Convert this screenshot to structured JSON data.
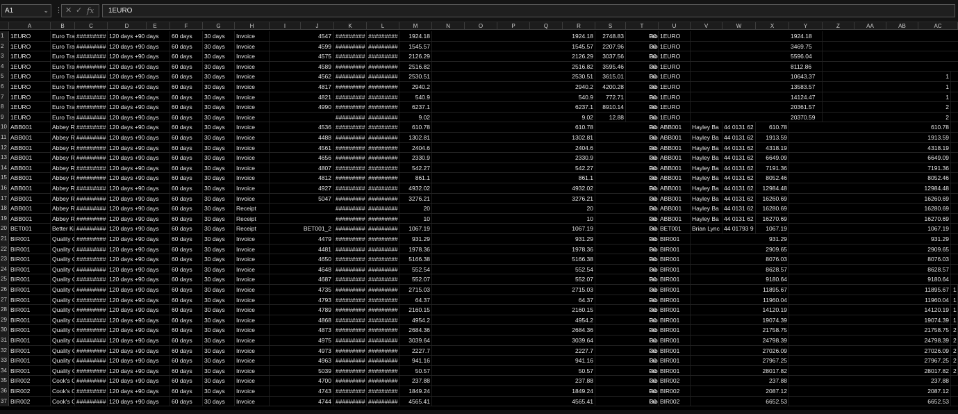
{
  "formula_bar": {
    "name_box": "A1",
    "formula": "1EURO",
    "icons": [
      "chevron-down-icon",
      "more-vertical-icon",
      "cancel-icon",
      "confirm-icon",
      "function-icon"
    ]
  },
  "columns": [
    "A",
    "B",
    "C",
    "D",
    "E",
    "F",
    "G",
    "H",
    "I",
    "J",
    "K",
    "L",
    "M",
    "N",
    "O",
    "P",
    "Q",
    "R",
    "S",
    "T",
    "U",
    "V",
    "W",
    "X",
    "Y",
    "Z",
    "AA",
    "AB",
    "AC"
  ],
  "rows": [
    {
      "n": "1",
      "A": "1EURO",
      "B": "Euro Tradi",
      "C": "#########",
      "D": "120 days +90 days",
      "F": "60 days",
      "G": "30 days",
      "H": "Invoice",
      "J": "4547",
      "K": "#########",
      "L": "#########",
      "M": "1924.18",
      "R": "1924.18",
      "S": "2748.83",
      "T": "30",
      "Tb": "From docu",
      "U": "1EURO",
      "V": "",
      "W": "",
      "X": "",
      "Y": "1924.18",
      "AC": ""
    },
    {
      "n": "2",
      "A": "1EURO",
      "B": "Euro Tradi",
      "C": "#########",
      "D": "120 days +90 days",
      "F": "60 days",
      "G": "30 days",
      "H": "Invoice",
      "J": "4599",
      "K": "#########",
      "L": "#########",
      "M": "1545.57",
      "R": "1545.57",
      "S": "2207.96",
      "T": "30",
      "Tb": "From docu",
      "U": "1EURO",
      "V": "",
      "W": "",
      "X": "",
      "Y": "3469.75",
      "AC": ""
    },
    {
      "n": "3",
      "A": "1EURO",
      "B": "Euro Tradi",
      "C": "#########",
      "D": "120 days +90 days",
      "F": "60 days",
      "G": "30 days",
      "H": "Invoice",
      "J": "4575",
      "K": "#########",
      "L": "#########",
      "M": "2126.29",
      "R": "2126.29",
      "S": "3037.56",
      "T": "30",
      "Tb": "From docu",
      "U": "1EURO",
      "V": "",
      "W": "",
      "X": "",
      "Y": "5596.04",
      "AC": ""
    },
    {
      "n": "4",
      "A": "1EURO",
      "B": "Euro Tradi",
      "C": "#########",
      "D": "120 days +90 days",
      "F": "60 days",
      "G": "30 days",
      "H": "Invoice",
      "J": "4589",
      "K": "#########",
      "L": "#########",
      "M": "2516.82",
      "R": "2516.82",
      "S": "3595.46",
      "T": "30",
      "Tb": "From docu",
      "U": "1EURO",
      "V": "",
      "W": "",
      "X": "",
      "Y": "8112.86",
      "AC": ""
    },
    {
      "n": "5",
      "A": "1EURO",
      "B": "Euro Tradi",
      "C": "#########",
      "D": "120 days +90 days",
      "F": "60 days",
      "G": "30 days",
      "H": "Invoice",
      "J": "4562",
      "K": "#########",
      "L": "#########",
      "M": "2530.51",
      "R": "2530.51",
      "S": "3615.01",
      "T": "30",
      "Tb": "From docu",
      "U": "1EURO",
      "V": "",
      "W": "",
      "X": "",
      "Y": "10643.37",
      "AC": "1"
    },
    {
      "n": "6",
      "A": "1EURO",
      "B": "Euro Tradi",
      "C": "#########",
      "D": "120 days +90 days",
      "F": "60 days",
      "G": "30 days",
      "H": "Invoice",
      "J": "4817",
      "K": "#########",
      "L": "#########",
      "M": "2940.2",
      "R": "2940.2",
      "S": "4200.28",
      "T": "30",
      "Tb": "From docu",
      "U": "1EURO",
      "V": "",
      "W": "",
      "X": "",
      "Y": "13583.57",
      "AC": "1"
    },
    {
      "n": "7",
      "A": "1EURO",
      "B": "Euro Tradi",
      "C": "#########",
      "D": "120 days +90 days",
      "F": "60 days",
      "G": "30 days",
      "H": "Invoice",
      "J": "4821",
      "K": "#########",
      "L": "#########",
      "M": "540.9",
      "R": "540.9",
      "S": "772.71",
      "T": "30",
      "Tb": "From docu",
      "U": "1EURO",
      "V": "",
      "W": "",
      "X": "",
      "Y": "14124.47",
      "AC": "1"
    },
    {
      "n": "8",
      "A": "1EURO",
      "B": "Euro Tradi",
      "C": "#########",
      "D": "120 days +90 days",
      "F": "60 days",
      "G": "30 days",
      "H": "Invoice",
      "J": "4990",
      "K": "#########",
      "L": "#########",
      "M": "6237.1",
      "R": "6237.1",
      "S": "8910.14",
      "T": "30",
      "Tb": "From docu",
      "U": "1EURO",
      "V": "",
      "W": "",
      "X": "",
      "Y": "20361.57",
      "AC": "2"
    },
    {
      "n": "9",
      "A": "1EURO",
      "B": "Euro Tradi",
      "C": "#########",
      "D": "120 days +90 days",
      "F": "60 days",
      "G": "30 days",
      "H": "Invoice",
      "J": "",
      "K": "#########",
      "L": "#########",
      "M": "9.02",
      "R": "9.02",
      "S": "12.88",
      "T": "30",
      "Tb": "From docu",
      "U": "1EURO",
      "V": "",
      "W": "",
      "X": "",
      "Y": "20370.59",
      "AC": "2"
    },
    {
      "n": "10",
      "A": "ABB001",
      "B": "Abbey Ret",
      "C": "#########",
      "D": "120 days +90 days",
      "F": "60 days",
      "G": "30 days",
      "H": "Invoice",
      "J": "4536",
      "K": "#########",
      "L": "#########",
      "M": "610.78",
      "R": "610.78",
      "S": "",
      "T": "30",
      "Tb": "From docu",
      "U": "ABB001",
      "V": "Hayley Ba",
      "W": "44 0131 62",
      "X": "610.78",
      "Y": "",
      "AC": "610.78"
    },
    {
      "n": "11",
      "A": "ABB001",
      "B": "Abbey Ret",
      "C": "#########",
      "D": "120 days +90 days",
      "F": "60 days",
      "G": "30 days",
      "H": "Invoice",
      "J": "4488",
      "K": "#########",
      "L": "#########",
      "M": "1302.81",
      "R": "1302.81",
      "S": "",
      "T": "30",
      "Tb": "From docu",
      "U": "ABB001",
      "V": "Hayley Ba",
      "W": "44 0131 62",
      "X": "1913.59",
      "Y": "",
      "AC": "1913.59"
    },
    {
      "n": "12",
      "A": "ABB001",
      "B": "Abbey Ret",
      "C": "#########",
      "D": "120 days +90 days",
      "F": "60 days",
      "G": "30 days",
      "H": "Invoice",
      "J": "4561",
      "K": "#########",
      "L": "#########",
      "M": "2404.6",
      "R": "2404.6",
      "S": "",
      "T": "30",
      "Tb": "From docu",
      "U": "ABB001",
      "V": "Hayley Ba",
      "W": "44 0131 62",
      "X": "4318.19",
      "Y": "",
      "AC": "4318.19"
    },
    {
      "n": "13",
      "A": "ABB001",
      "B": "Abbey Ret",
      "C": "#########",
      "D": "120 days +90 days",
      "F": "60 days",
      "G": "30 days",
      "H": "Invoice",
      "J": "4656",
      "K": "#########",
      "L": "#########",
      "M": "2330.9",
      "R": "2330.9",
      "S": "",
      "T": "30",
      "Tb": "From docu",
      "U": "ABB001",
      "V": "Hayley Ba",
      "W": "44 0131 62",
      "X": "6649.09",
      "Y": "",
      "AC": "6649.09"
    },
    {
      "n": "14",
      "A": "ABB001",
      "B": "Abbey Ret",
      "C": "#########",
      "D": "120 days +90 days",
      "F": "60 days",
      "G": "30 days",
      "H": "Invoice",
      "J": "4807",
      "K": "#########",
      "L": "#########",
      "M": "542.27",
      "R": "542.27",
      "S": "",
      "T": "30",
      "Tb": "From docu",
      "U": "ABB001",
      "V": "Hayley Ba",
      "W": "44 0131 62",
      "X": "7191.36",
      "Y": "",
      "AC": "7191.36"
    },
    {
      "n": "15",
      "A": "ABB001",
      "B": "Abbey Ret",
      "C": "#########",
      "D": "120 days +90 days",
      "F": "60 days",
      "G": "30 days",
      "H": "Invoice",
      "J": "4812",
      "K": "#########",
      "L": "#########",
      "M": "861.1",
      "R": "861.1",
      "S": "",
      "T": "30",
      "Tb": "From docu",
      "U": "ABB001",
      "V": "Hayley Ba",
      "W": "44 0131 62",
      "X": "8052.46",
      "Y": "",
      "AC": "8052.46"
    },
    {
      "n": "16",
      "A": "ABB001",
      "B": "Abbey Ret",
      "C": "#########",
      "D": "120 days +90 days",
      "F": "60 days",
      "G": "30 days",
      "H": "Invoice",
      "J": "4927",
      "K": "#########",
      "L": "#########",
      "M": "4932.02",
      "R": "4932.02",
      "S": "",
      "T": "30",
      "Tb": "From docu",
      "U": "ABB001",
      "V": "Hayley Ba",
      "W": "44 0131 62",
      "X": "12984.48",
      "Y": "",
      "AC": "12984.48"
    },
    {
      "n": "17",
      "A": "ABB001",
      "B": "Abbey Ret",
      "C": "#########",
      "D": "120 days +90 days",
      "F": "60 days",
      "G": "30 days",
      "H": "Invoice",
      "J": "5047",
      "K": "#########",
      "L": "#########",
      "M": "3276.21",
      "R": "3276.21",
      "S": "",
      "T": "30",
      "Tb": "From docu",
      "U": "ABB001",
      "V": "Hayley Ba",
      "W": "44 0131 62",
      "X": "16260.69",
      "Y": "",
      "AC": "16260.69"
    },
    {
      "n": "18",
      "A": "ABB001",
      "B": "Abbey Ret",
      "C": "#########",
      "D": "120 days +90 days",
      "F": "60 days",
      "G": "30 days",
      "H": "Receipt",
      "J": "",
      "K": "#########",
      "L": "#########",
      "M": "20",
      "R": "20",
      "S": "",
      "T": "30",
      "Tb": "From docu",
      "U": "ABB001",
      "V": "Hayley Ba",
      "W": "44 0131 62",
      "X": "16280.69",
      "Y": "",
      "AC": "16280.69"
    },
    {
      "n": "19",
      "A": "ABB001",
      "B": "Abbey Ret",
      "C": "#########",
      "D": "120 days +90 days",
      "F": "60 days",
      "G": "30 days",
      "H": "Receipt",
      "J": "",
      "K": "#########",
      "L": "#########",
      "M": "10",
      "R": "10",
      "S": "",
      "T": "30",
      "Tb": "From docu",
      "U": "ABB001",
      "V": "Hayley Ba",
      "W": "44 0131 62",
      "X": "16270.69",
      "Y": "",
      "AC": "16270.69"
    },
    {
      "n": "20",
      "A": "BET001",
      "B": "Better Kit",
      "C": "#########",
      "D": "120 days +90 days",
      "F": "60 days",
      "G": "30 days",
      "H": "Receipt",
      "J": "BET001_2",
      "K": "#########",
      "L": "#########",
      "M": "1067.19",
      "R": "1067.19",
      "S": "",
      "T": "30",
      "Tb": "From docu",
      "U": "BET001",
      "V": "Brian Lync",
      "W": "44 01793 9",
      "X": "1067.19",
      "Y": "",
      "AC": "1067.19"
    },
    {
      "n": "21",
      "A": "BIR001",
      "B": "Quality Co",
      "C": "#########",
      "D": "120 days +90 days",
      "F": "60 days",
      "G": "30 days",
      "H": "Invoice",
      "J": "4479",
      "K": "#########",
      "L": "#########",
      "M": "931.29",
      "R": "931.29",
      "S": "",
      "T": "30",
      "Tb": "From docu",
      "U": "BIR001",
      "V": "",
      "W": "",
      "X": "931.29",
      "Y": "",
      "AC": "931.29"
    },
    {
      "n": "22",
      "A": "BIR001",
      "B": "Quality Co",
      "C": "#########",
      "D": "120 days +90 days",
      "F": "60 days",
      "G": "30 days",
      "H": "Invoice",
      "J": "4481",
      "K": "#########",
      "L": "#########",
      "M": "1978.36",
      "R": "1978.36",
      "S": "",
      "T": "30",
      "Tb": "From docu",
      "U": "BIR001",
      "V": "",
      "W": "",
      "X": "2909.65",
      "Y": "",
      "AC": "2909.65"
    },
    {
      "n": "23",
      "A": "BIR001",
      "B": "Quality Co",
      "C": "#########",
      "D": "120 days +90 days",
      "F": "60 days",
      "G": "30 days",
      "H": "Invoice",
      "J": "4650",
      "K": "#########",
      "L": "#########",
      "M": "5166.38",
      "R": "5166.38",
      "S": "",
      "T": "30",
      "Tb": "From docu",
      "U": "BIR001",
      "V": "",
      "W": "",
      "X": "8076.03",
      "Y": "",
      "AC": "8076.03"
    },
    {
      "n": "24",
      "A": "BIR001",
      "B": "Quality Co",
      "C": "#########",
      "D": "120 days +90 days",
      "F": "60 days",
      "G": "30 days",
      "H": "Invoice",
      "J": "4648",
      "K": "#########",
      "L": "#########",
      "M": "552.54",
      "R": "552.54",
      "S": "",
      "T": "30",
      "Tb": "From docu",
      "U": "BIR001",
      "V": "",
      "W": "",
      "X": "8628.57",
      "Y": "",
      "AC": "8628.57"
    },
    {
      "n": "25",
      "A": "BIR001",
      "B": "Quality Co",
      "C": "#########",
      "D": "120 days +90 days",
      "F": "60 days",
      "G": "30 days",
      "H": "Invoice",
      "J": "4687",
      "K": "#########",
      "L": "#########",
      "M": "552.07",
      "R": "552.07",
      "S": "",
      "T": "30",
      "Tb": "From docu",
      "U": "BIR001",
      "V": "",
      "W": "",
      "X": "9180.64",
      "Y": "",
      "AC": "9180.64"
    },
    {
      "n": "26",
      "A": "BIR001",
      "B": "Quality Co",
      "C": "#########",
      "D": "120 days +90 days",
      "F": "60 days",
      "G": "30 days",
      "H": "Invoice",
      "J": "4735",
      "K": "#########",
      "L": "#########",
      "M": "2715.03",
      "R": "2715.03",
      "S": "",
      "T": "30",
      "Tb": "From docu",
      "U": "BIR001",
      "V": "",
      "W": "",
      "X": "11895.67",
      "Y": "",
      "AC": "11895.67",
      "ACb": "1"
    },
    {
      "n": "27",
      "A": "BIR001",
      "B": "Quality Co",
      "C": "#########",
      "D": "120 days +90 days",
      "F": "60 days",
      "G": "30 days",
      "H": "Invoice",
      "J": "4793",
      "K": "#########",
      "L": "#########",
      "M": "64.37",
      "R": "64.37",
      "S": "",
      "T": "30",
      "Tb": "From docu",
      "U": "BIR001",
      "V": "",
      "W": "",
      "X": "11960.04",
      "Y": "",
      "AC": "11960.04",
      "ACb": "1"
    },
    {
      "n": "28",
      "A": "BIR001",
      "B": "Quality Co",
      "C": "#########",
      "D": "120 days +90 days",
      "F": "60 days",
      "G": "30 days",
      "H": "Invoice",
      "J": "4789",
      "K": "#########",
      "L": "#########",
      "M": "2160.15",
      "R": "2160.15",
      "S": "",
      "T": "30",
      "Tb": "From docu",
      "U": "BIR001",
      "V": "",
      "W": "",
      "X": "14120.19",
      "Y": "",
      "AC": "14120.19",
      "ACb": "1"
    },
    {
      "n": "29",
      "A": "BIR001",
      "B": "Quality Co",
      "C": "#########",
      "D": "120 days +90 days",
      "F": "60 days",
      "G": "30 days",
      "H": "Invoice",
      "J": "4868",
      "K": "#########",
      "L": "#########",
      "M": "4954.2",
      "R": "4954.2",
      "S": "",
      "T": "30",
      "Tb": "From docu",
      "U": "BIR001",
      "V": "",
      "W": "",
      "X": "19074.39",
      "Y": "",
      "AC": "19074.39",
      "ACb": "1"
    },
    {
      "n": "30",
      "A": "BIR001",
      "B": "Quality Co",
      "C": "#########",
      "D": "120 days +90 days",
      "F": "60 days",
      "G": "30 days",
      "H": "Invoice",
      "J": "4873",
      "K": "#########",
      "L": "#########",
      "M": "2684.36",
      "R": "2684.36",
      "S": "",
      "T": "30",
      "Tb": "From docu",
      "U": "BIR001",
      "V": "",
      "W": "",
      "X": "21758.75",
      "Y": "",
      "AC": "21758.75",
      "ACb": "2"
    },
    {
      "n": "31",
      "A": "BIR001",
      "B": "Quality Co",
      "C": "#########",
      "D": "120 days +90 days",
      "F": "60 days",
      "G": "30 days",
      "H": "Invoice",
      "J": "4975",
      "K": "#########",
      "L": "#########",
      "M": "3039.64",
      "R": "3039.64",
      "S": "",
      "T": "30",
      "Tb": "From docu",
      "U": "BIR001",
      "V": "",
      "W": "",
      "X": "24798.39",
      "Y": "",
      "AC": "24798.39",
      "ACb": "2"
    },
    {
      "n": "32",
      "A": "BIR001",
      "B": "Quality Co",
      "C": "#########",
      "D": "120 days +90 days",
      "F": "60 days",
      "G": "30 days",
      "H": "Invoice",
      "J": "4973",
      "K": "#########",
      "L": "#########",
      "M": "2227.7",
      "R": "2227.7",
      "S": "",
      "T": "30",
      "Tb": "From docu",
      "U": "BIR001",
      "V": "",
      "W": "",
      "X": "27026.09",
      "Y": "",
      "AC": "27026.09",
      "ACb": "2"
    },
    {
      "n": "33",
      "A": "BIR001",
      "B": "Quality Co",
      "C": "#########",
      "D": "120 days +90 days",
      "F": "60 days",
      "G": "30 days",
      "H": "Invoice",
      "J": "4963",
      "K": "#########",
      "L": "#########",
      "M": "941.16",
      "R": "941.16",
      "S": "",
      "T": "30",
      "Tb": "From docu",
      "U": "BIR001",
      "V": "",
      "W": "",
      "X": "27967.25",
      "Y": "",
      "AC": "27967.25",
      "ACb": "2"
    },
    {
      "n": "34",
      "A": "BIR001",
      "B": "Quality Co",
      "C": "#########",
      "D": "120 days +90 days",
      "F": "60 days",
      "G": "30 days",
      "H": "Invoice",
      "J": "5039",
      "K": "#########",
      "L": "#########",
      "M": "50.57",
      "R": "50.57",
      "S": "",
      "T": "30",
      "Tb": "From docu",
      "U": "BIR001",
      "V": "",
      "W": "",
      "X": "28017.82",
      "Y": "",
      "AC": "28017.82",
      "ACb": "2"
    },
    {
      "n": "35",
      "A": "BIR002",
      "B": "Cook's Co",
      "C": "#########",
      "D": "120 days +90 days",
      "F": "60 days",
      "G": "30 days",
      "H": "Invoice",
      "J": "4700",
      "K": "#########",
      "L": "#########",
      "M": "237.88",
      "R": "237.88",
      "S": "",
      "T": "30",
      "Tb": "From docu",
      "U": "BIR002",
      "V": "",
      "W": "",
      "X": "237.88",
      "Y": "",
      "AC": "237.88"
    },
    {
      "n": "36",
      "A": "BIR002",
      "B": "Cook's Co",
      "C": "#########",
      "D": "120 days +90 days",
      "F": "60 days",
      "G": "30 days",
      "H": "Invoice",
      "J": "4743",
      "K": "#########",
      "L": "#########",
      "M": "1849.24",
      "R": "1849.24",
      "S": "",
      "T": "30",
      "Tb": "From docu",
      "U": "BIR002",
      "V": "",
      "W": "",
      "X": "2087.12",
      "Y": "",
      "AC": "2087.12"
    },
    {
      "n": "37",
      "A": "BIR002",
      "B": "Cook's Co",
      "C": "#########",
      "D": "120 days +90 days",
      "F": "60 days",
      "G": "30 days",
      "H": "Invoice",
      "J": "4744",
      "K": "#########",
      "L": "#########",
      "M": "4565.41",
      "R": "4565.41",
      "S": "",
      "T": "30",
      "Tb": "From docu",
      "U": "BIR002",
      "V": "",
      "W": "",
      "X": "6652.53",
      "Y": "",
      "AC": "6652.53"
    }
  ]
}
